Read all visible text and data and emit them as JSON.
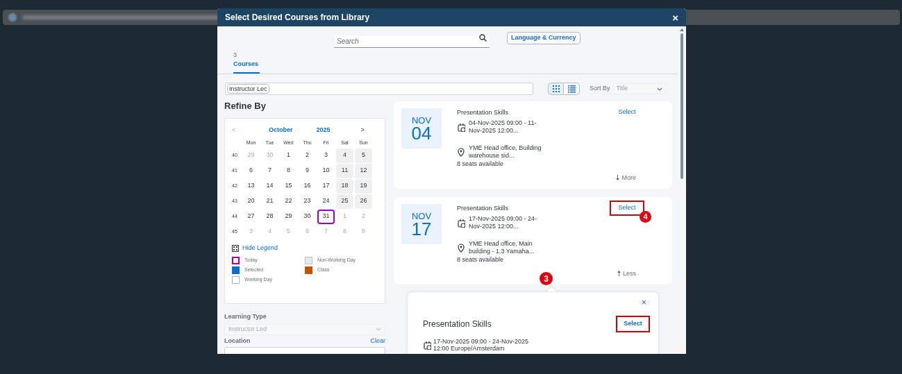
{
  "dialog": {
    "title": "Select Desired Courses from Library",
    "close": "×"
  },
  "search": {
    "placeholder": "Search"
  },
  "language_button": "Language & Currency",
  "tabs": [
    {
      "count": "3",
      "label": "Courses",
      "selected": true
    }
  ],
  "filter_token": "Instructor Lec",
  "view_toggle": [
    {
      "kind": "grid",
      "selected": true
    },
    {
      "kind": "list",
      "selected": false
    }
  ],
  "sort": {
    "label": "Sort By",
    "value": "Title"
  },
  "refine": {
    "title": "Refine By",
    "calendar": {
      "prev": "<",
      "month": "October",
      "year": "2025",
      "next": ">",
      "weekdays": [
        "Mon",
        "Tue",
        "Wed",
        "Thu",
        "Fri",
        "Sat",
        "Sun"
      ],
      "weeks": [
        {
          "number": "40",
          "days": [
            {
              "label": "29",
              "in_month": false,
              "non_working": false,
              "today": false
            },
            {
              "label": "30",
              "in_month": false,
              "non_working": false,
              "today": false
            },
            {
              "label": "1",
              "in_month": true,
              "non_working": false,
              "today": false
            },
            {
              "label": "2",
              "in_month": true,
              "non_working": false,
              "today": false
            },
            {
              "label": "3",
              "in_month": true,
              "non_working": false,
              "today": false
            },
            {
              "label": "4",
              "in_month": true,
              "non_working": true,
              "today": false
            },
            {
              "label": "5",
              "in_month": true,
              "non_working": true,
              "today": false
            }
          ]
        },
        {
          "number": "41",
          "days": [
            {
              "label": "6",
              "in_month": true,
              "non_working": false,
              "today": false
            },
            {
              "label": "7",
              "in_month": true,
              "non_working": false,
              "today": false
            },
            {
              "label": "8",
              "in_month": true,
              "non_working": false,
              "today": false
            },
            {
              "label": "9",
              "in_month": true,
              "non_working": false,
              "today": false
            },
            {
              "label": "10",
              "in_month": true,
              "non_working": false,
              "today": false
            },
            {
              "label": "11",
              "in_month": true,
              "non_working": true,
              "today": false
            },
            {
              "label": "12",
              "in_month": true,
              "non_working": true,
              "today": false
            }
          ]
        },
        {
          "number": "42",
          "days": [
            {
              "label": "13",
              "in_month": true,
              "non_working": false,
              "today": false
            },
            {
              "label": "14",
              "in_month": true,
              "non_working": false,
              "today": false
            },
            {
              "label": "15",
              "in_month": true,
              "non_working": false,
              "today": false
            },
            {
              "label": "16",
              "in_month": true,
              "non_working": false,
              "today": false
            },
            {
              "label": "17",
              "in_month": true,
              "non_working": false,
              "today": false
            },
            {
              "label": "18",
              "in_month": true,
              "non_working": true,
              "today": false
            },
            {
              "label": "19",
              "in_month": true,
              "non_working": true,
              "today": false
            }
          ]
        },
        {
          "number": "43",
          "days": [
            {
              "label": "20",
              "in_month": true,
              "non_working": false,
              "today": false
            },
            {
              "label": "21",
              "in_month": true,
              "non_working": false,
              "today": false
            },
            {
              "label": "22",
              "in_month": true,
              "non_working": false,
              "today": false
            },
            {
              "label": "23",
              "in_month": true,
              "non_working": false,
              "today": false
            },
            {
              "label": "24",
              "in_month": true,
              "non_working": false,
              "today": false
            },
            {
              "label": "25",
              "in_month": true,
              "non_working": true,
              "today": false
            },
            {
              "label": "26",
              "in_month": true,
              "non_working": true,
              "today": false
            }
          ]
        },
        {
          "number": "44",
          "days": [
            {
              "label": "27",
              "in_month": true,
              "non_working": false,
              "today": false
            },
            {
              "label": "28",
              "in_month": true,
              "non_working": false,
              "today": false
            },
            {
              "label": "29",
              "in_month": true,
              "non_working": false,
              "today": false
            },
            {
              "label": "30",
              "in_month": true,
              "non_working": false,
              "today": false
            },
            {
              "label": "31",
              "in_month": true,
              "non_working": false,
              "today": true
            },
            {
              "label": "1",
              "in_month": false,
              "non_working": false,
              "today": false
            },
            {
              "label": "2",
              "in_month": false,
              "non_working": false,
              "today": false
            }
          ]
        },
        {
          "number": "45",
          "days": [
            {
              "label": "3",
              "in_month": false,
              "non_working": false,
              "today": false
            },
            {
              "label": "4",
              "in_month": false,
              "non_working": false,
              "today": false
            },
            {
              "label": "5",
              "in_month": false,
              "non_working": false,
              "today": false
            },
            {
              "label": "6",
              "in_month": false,
              "non_working": false,
              "today": false
            },
            {
              "label": "7",
              "in_month": false,
              "non_working": false,
              "today": false
            },
            {
              "label": "8",
              "in_month": false,
              "non_working": false,
              "today": false
            },
            {
              "label": "9",
              "in_month": false,
              "non_working": false,
              "today": false
            }
          ]
        }
      ],
      "legend_toggle": "Hide Legend",
      "legend": [
        {
          "kind": "today",
          "label": "Today"
        },
        {
          "kind": "non_working",
          "label": "Non-Working Day"
        },
        {
          "kind": "selected",
          "label": "Selected"
        },
        {
          "kind": "class",
          "label": "Class"
        },
        {
          "kind": "working",
          "label": "Working Day"
        }
      ]
    },
    "learning_type": {
      "label": "Learning Type",
      "value": "Instructor Led"
    },
    "location": {
      "label": "Location",
      "clear": "Clear"
    }
  },
  "sessions": [
    {
      "month": "NOV",
      "day": "04",
      "title": "Presentation Skills",
      "select": "Select",
      "highlighted": false,
      "dates": "04-Nov-2025 09:00 - 11-Nov-2025 12:00...",
      "location": "YME Head office, Building warehouse sid...",
      "seats": "8 seats available",
      "toggle": "More",
      "expanded": false
    },
    {
      "month": "NOV",
      "day": "17",
      "title": "Presentation Skills",
      "select": "Select",
      "highlighted": true,
      "marker": "4",
      "dates": "17-Nov-2025 09:00 - 24-Nov-2025 12:00...",
      "location": "YME Head office, Main building - 1.3 Yamaha...",
      "seats": "8 seats available",
      "toggle": "Less",
      "expanded": true
    }
  ],
  "popover": {
    "marker": "3",
    "close": "×",
    "title": "Presentation Skills",
    "select": "Select",
    "highlighted": true,
    "dates": "17-Nov-2025 09:00 - 24-Nov-2025 12:00 Europe/Amsterdam"
  }
}
